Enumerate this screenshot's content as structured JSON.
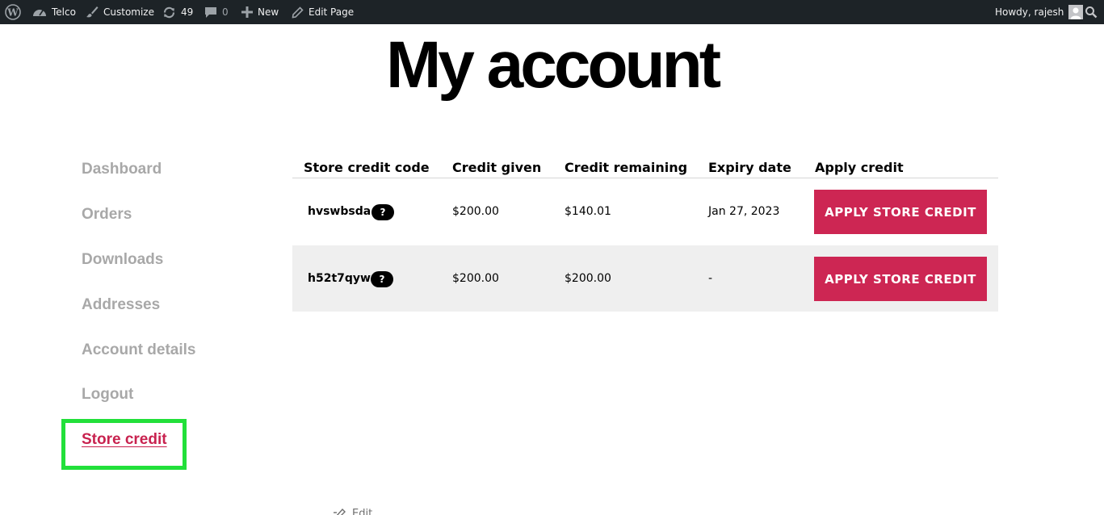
{
  "admin_bar": {
    "site_name": "Telco",
    "customize": "Customize",
    "updates_count": "49",
    "comments_count": "0",
    "new_label": "New",
    "edit_page": "Edit Page",
    "greeting": "Howdy, rajesh"
  },
  "page": {
    "title": "My account"
  },
  "sidebar": {
    "items": [
      {
        "label": "Dashboard"
      },
      {
        "label": "Orders"
      },
      {
        "label": "Downloads"
      },
      {
        "label": "Addresses"
      },
      {
        "label": "Account details"
      },
      {
        "label": "Logout"
      },
      {
        "label": "Store credit"
      }
    ],
    "active_item": "Store credit"
  },
  "table": {
    "columns": [
      "Store credit code",
      "Credit given",
      "Credit remaining",
      "Expiry date",
      "Apply credit"
    ],
    "rows": [
      {
        "code": "hvswbsda",
        "help": "?",
        "given": "$200.00",
        "remaining": "$140.01",
        "expiry": "Jan 27, 2023",
        "action": "APPLY STORE CREDIT"
      },
      {
        "code": "h52t7qyw",
        "help": "?",
        "given": "$200.00",
        "remaining": "$200.00",
        "expiry": "-",
        "action": "APPLY STORE CREDIT"
      }
    ]
  },
  "footer": {
    "edit_label": "Edit"
  },
  "colors": {
    "admin_bar_bg": "#1d2327",
    "accent": "#cd2653",
    "nav_muted": "#a8a8a8",
    "highlight": "#22e03a",
    "row_alt_bg": "#efefef"
  },
  "icons": [
    "wordpress-icon",
    "dashboard-icon",
    "brush-icon",
    "refresh-icon",
    "comment-icon",
    "plus-icon",
    "pencil-icon",
    "avatar",
    "search-icon",
    "edit-icon"
  ]
}
